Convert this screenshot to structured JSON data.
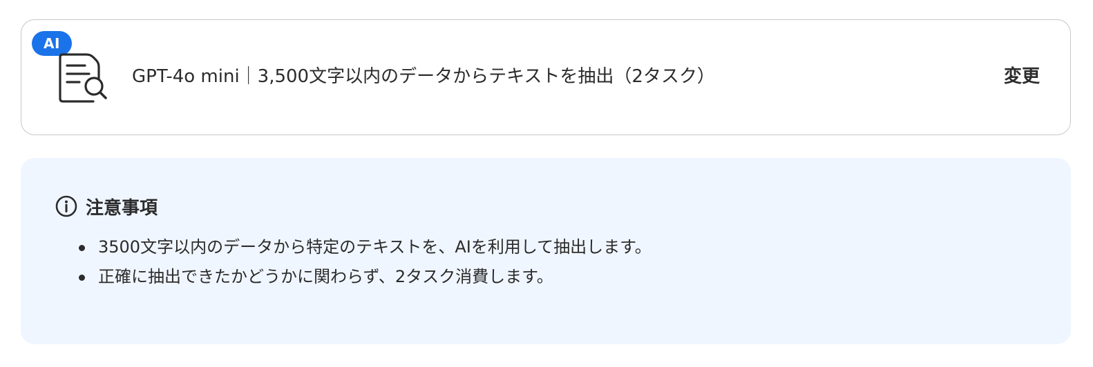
{
  "action_card": {
    "badge": "AI",
    "icon": "document-search-icon",
    "label": "GPT-4o mini｜3,500文字以内のデータからテキストを抽出（2タスク）",
    "change_label": "変更"
  },
  "notice": {
    "icon": "info-icon",
    "title": "注意事項",
    "items": [
      "3500文字以内のデータから特定のテキストを、AIを利用して抽出します。",
      "正確に抽出できたかどうかに関わらず、2タスク消費します。"
    ]
  },
  "colors": {
    "accent": "#1a73e8",
    "panel_background": "#f0f6ff",
    "card_border": "#c4c8cc",
    "text": "#2b2b2b"
  }
}
